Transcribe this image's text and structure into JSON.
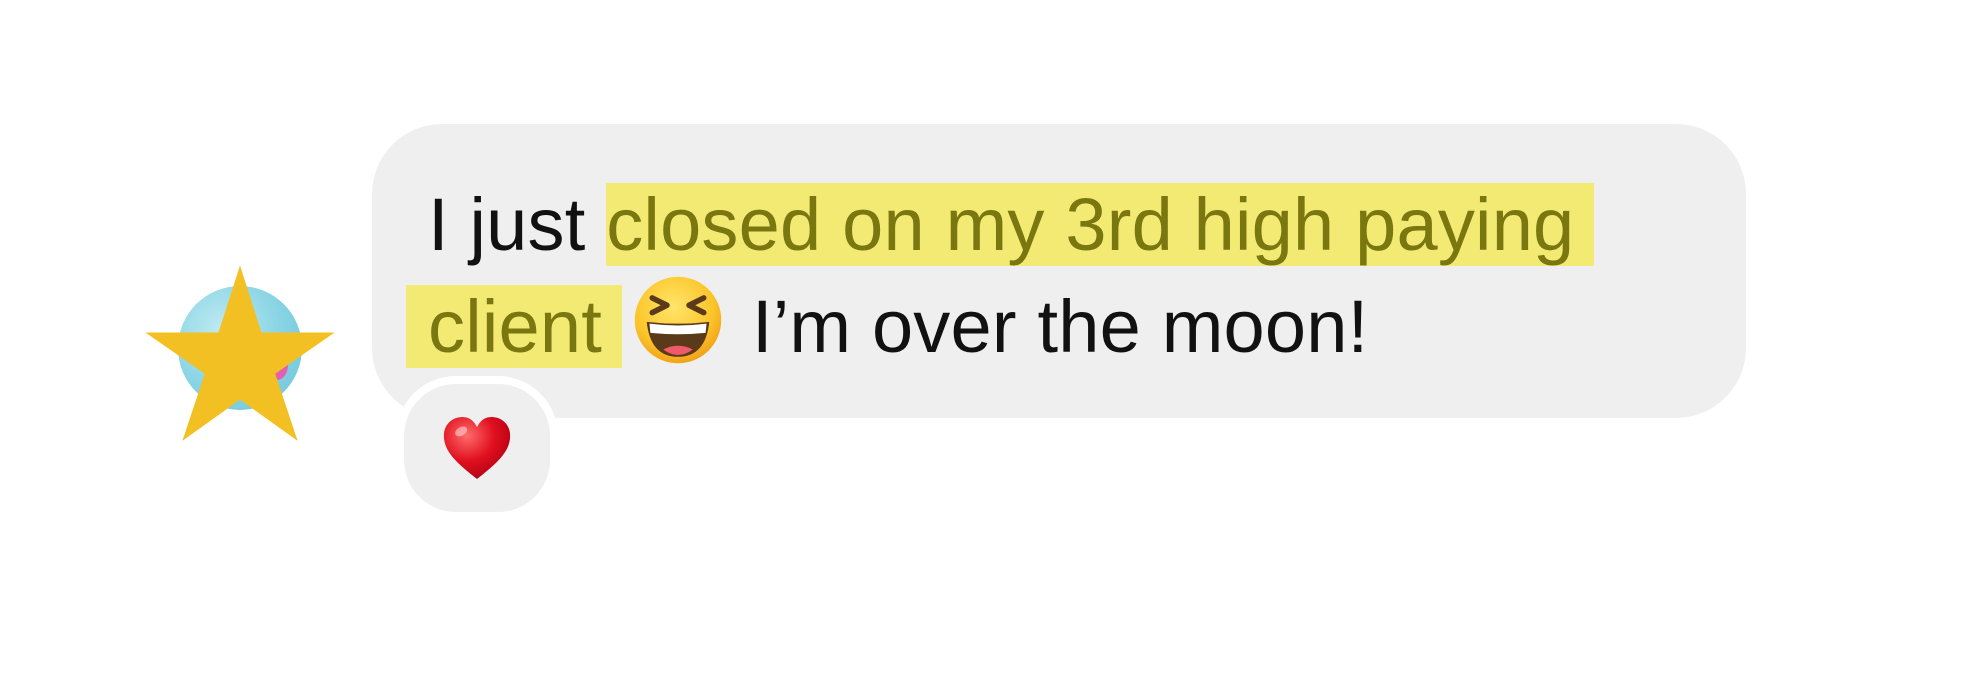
{
  "message": {
    "line1_plain": "I just ",
    "line1_highlight": "closed on my 3rd high paying",
    "line2_highlight": "client",
    "line2_plain": "I’m over the moon!",
    "emoji": "grinning-squinting-face-icon",
    "highlight_color": "#f3ea74",
    "bubble_color": "#efefef"
  },
  "reaction": {
    "icon": "red-heart-icon",
    "color": "#e0101f"
  },
  "avatar": {
    "overlay_icon": "star-icon",
    "overlay_color": "#f2c022"
  }
}
